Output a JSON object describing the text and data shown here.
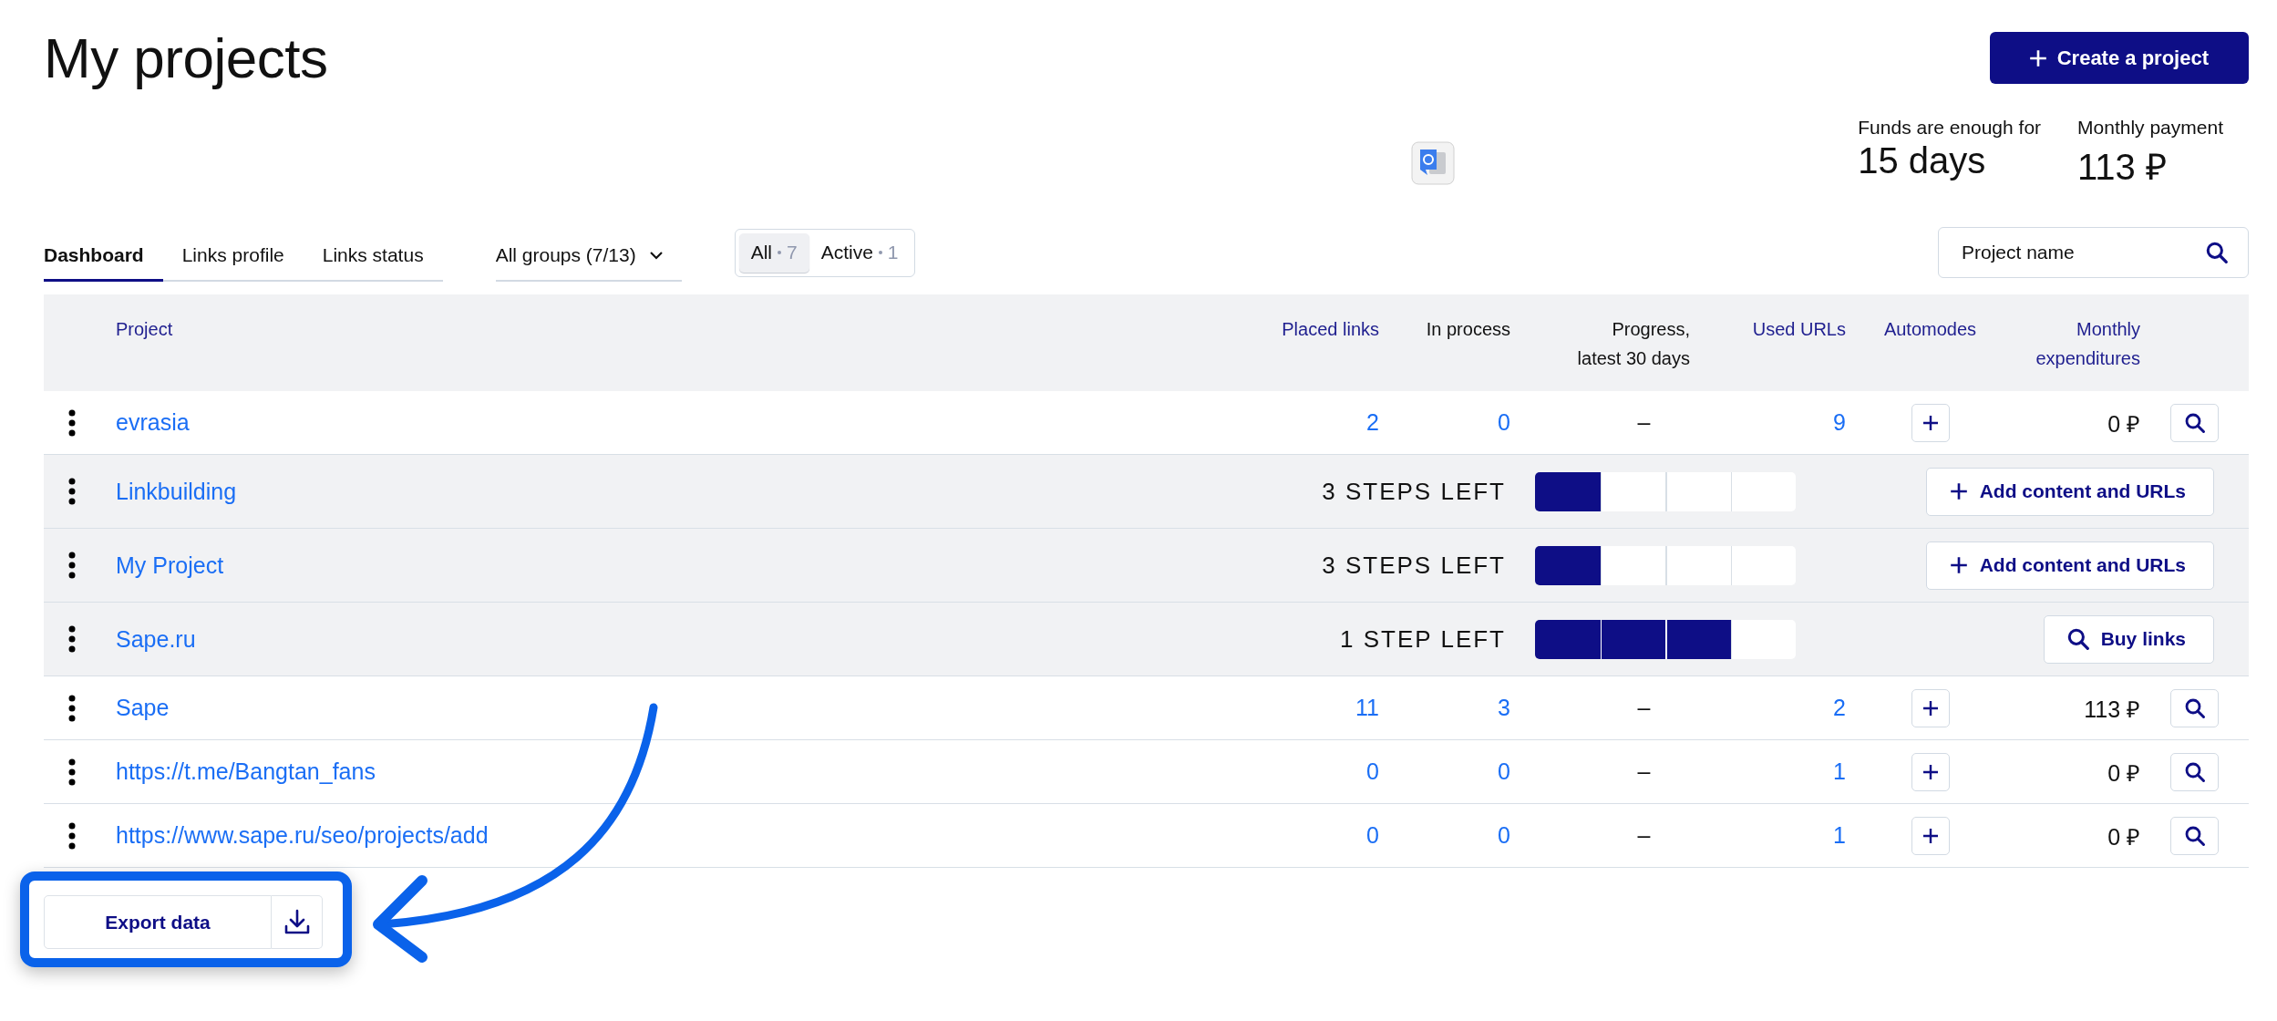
{
  "title": "My projects",
  "create_button": {
    "label": "Create a project"
  },
  "stats": [
    {
      "label": "Funds are enough for",
      "value": "15 days"
    },
    {
      "label": "Monthly payment",
      "value": "113 ₽"
    }
  ],
  "tabs": [
    {
      "label": "Dashboard",
      "selected": true
    },
    {
      "label": "Links profile",
      "selected": false
    },
    {
      "label": "Links status",
      "selected": false
    }
  ],
  "group_filter": {
    "label": "All groups (7/13)"
  },
  "status_filter": [
    {
      "label": "All",
      "count": "7",
      "selected": true
    },
    {
      "label": "Active",
      "count": "1",
      "selected": false
    }
  ],
  "search": {
    "placeholder": "Project name"
  },
  "table": {
    "columns": [
      {
        "label": "Project",
        "kind": "link"
      },
      {
        "label": "Placed links",
        "kind": "link"
      },
      {
        "label": "In process",
        "kind": "plain"
      },
      {
        "label": "Progress, latest 30 days",
        "kind": "plain"
      },
      {
        "label": "Used URLs",
        "kind": "link"
      },
      {
        "label": "Automodes",
        "kind": "link"
      },
      {
        "label": "Monthly expenditures",
        "kind": "link"
      }
    ],
    "rows": [
      {
        "kind": "stats",
        "name": "evrasia",
        "placed": "2",
        "in_process": "0",
        "progress": "–",
        "used_urls": "9",
        "monthly": "0 ₽"
      },
      {
        "kind": "setup",
        "name": "Linkbuilding",
        "steps_left": "3 STEPS LEFT",
        "level": 0.25,
        "action": {
          "kind": "add",
          "label": "Add content and URLs"
        }
      },
      {
        "kind": "setup",
        "name": "My Project",
        "steps_left": "3 STEPS LEFT",
        "level": 0.25,
        "action": {
          "kind": "add",
          "label": "Add content and URLs"
        }
      },
      {
        "kind": "setup",
        "name": "Sape.ru",
        "steps_left": "1 STEP LEFT",
        "level": 0.75,
        "action": {
          "kind": "buy",
          "label": "Buy links"
        }
      },
      {
        "kind": "stats",
        "name": "Sape",
        "placed": "11",
        "in_process": "3",
        "progress": "–",
        "used_urls": "2",
        "monthly": "113 ₽"
      },
      {
        "kind": "stats",
        "name": "https://t.me/Bangtan_fans",
        "placed": "0",
        "in_process": "0",
        "progress": "–",
        "used_urls": "1",
        "monthly": "0 ₽"
      },
      {
        "kind": "stats",
        "name": "https://www.sape.ru/seo/projects/add",
        "placed": "0",
        "in_process": "0",
        "progress": "–",
        "used_urls": "1",
        "monthly": "0 ₽"
      }
    ]
  },
  "export_button": {
    "label": "Export data"
  }
}
